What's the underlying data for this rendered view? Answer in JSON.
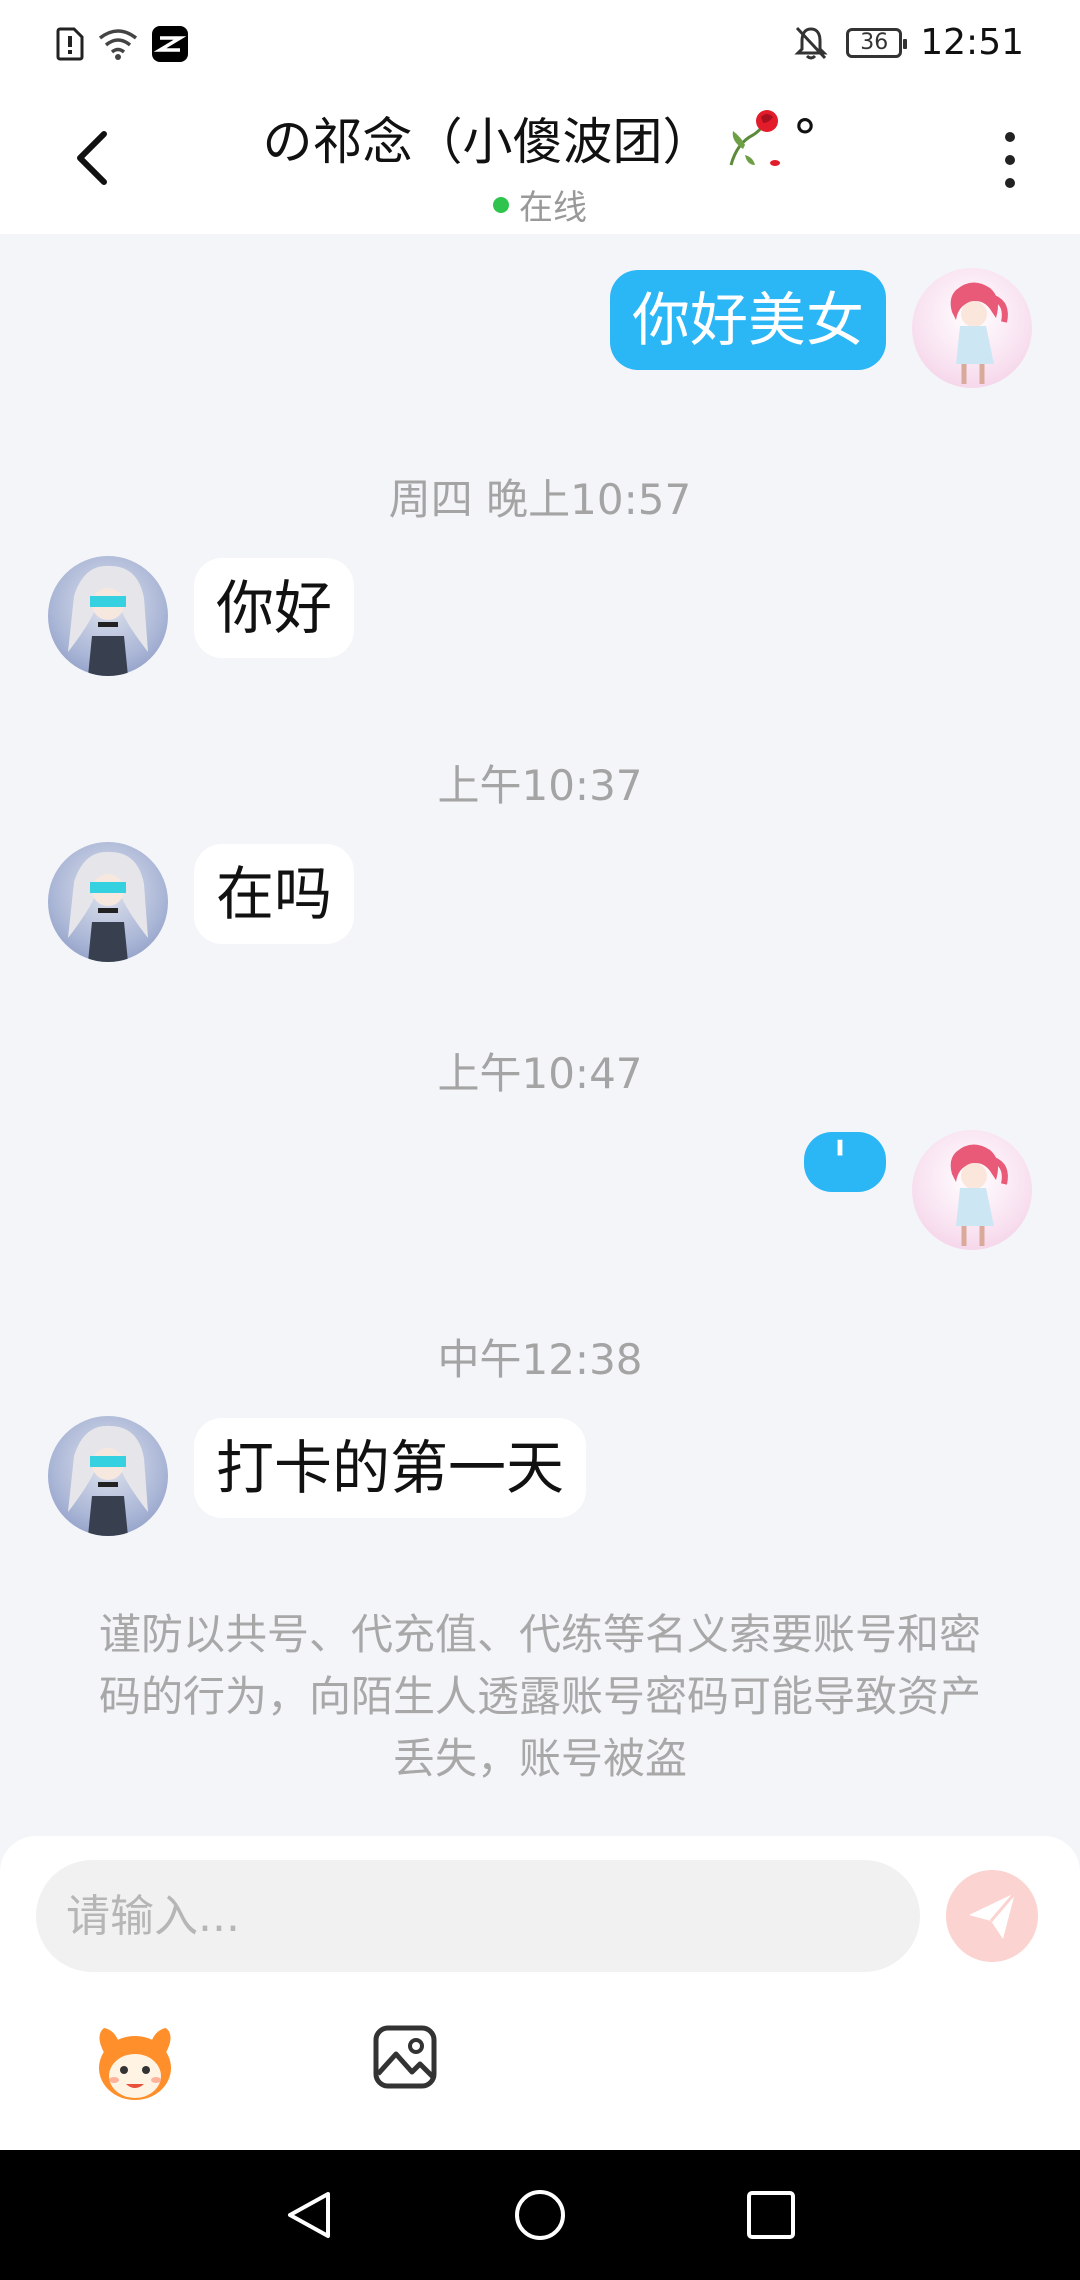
{
  "status_bar": {
    "time": "12:51",
    "battery": "36"
  },
  "header": {
    "title": "の祁念（小傻波团）",
    "title_suffix": "°",
    "presence": "在线"
  },
  "messages": [
    {
      "side": "me",
      "text": "你好美女"
    },
    {
      "type": "time",
      "text": "周四 晚上10:57"
    },
    {
      "side": "peer",
      "text": "你好"
    },
    {
      "type": "time",
      "text": "上午10:37"
    },
    {
      "side": "peer",
      "text": "在吗"
    },
    {
      "type": "time",
      "text": "上午10:47"
    },
    {
      "side": "me",
      "text": "'"
    },
    {
      "type": "time",
      "text": "中午12:38"
    },
    {
      "side": "peer",
      "text": "打卡的第一天"
    }
  ],
  "notice": "谨防以共号、代充值、代练等名义索要账号和密码的行为，向陌生人透露账号密码可能导致资产丢失，账号被盗",
  "composer": {
    "placeholder": "请输入...",
    "value": ""
  },
  "colors": {
    "my_bubble": "#2bb6f6",
    "peer_bubble": "#ffffff",
    "background": "#f4f5f9",
    "online": "#2fc44e",
    "send_button": "#fbd3d0"
  },
  "icons": {
    "back": "chevron-left-icon",
    "more": "more-vertical-icon",
    "send": "paper-plane-icon",
    "emoji": "mascot-emoji-icon",
    "image": "image-icon"
  }
}
